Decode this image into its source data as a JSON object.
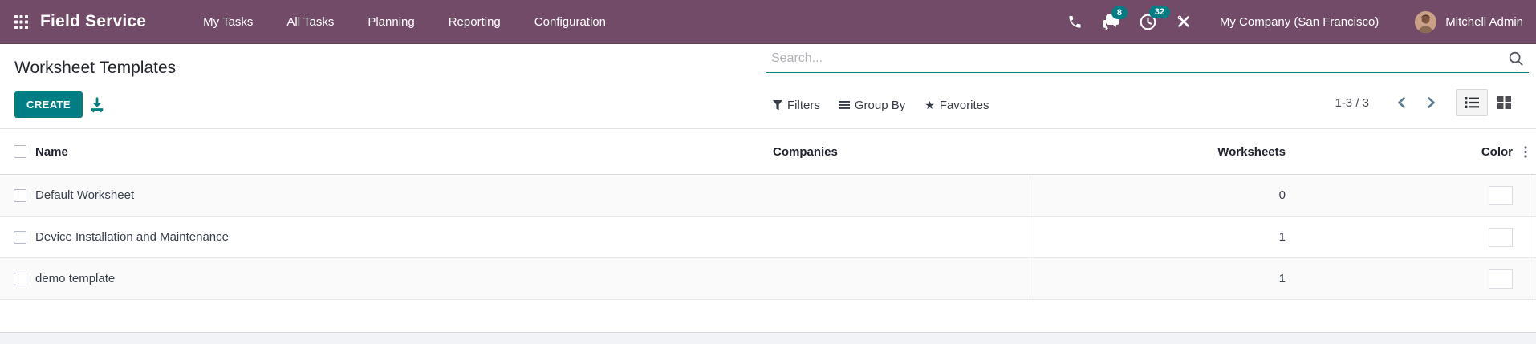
{
  "navbar": {
    "app_name": "Field Service",
    "menu_items": [
      "My Tasks",
      "All Tasks",
      "Planning",
      "Reporting",
      "Configuration"
    ],
    "messages_badge": "8",
    "activities_badge": "32",
    "company_name": "My Company (San Francisco)",
    "user_name": "Mitchell Admin"
  },
  "control_panel": {
    "title": "Worksheet Templates",
    "search_placeholder": "Search...",
    "create_label": "CREATE",
    "filters_label": "Filters",
    "group_by_label": "Group By",
    "favorites_label": "Favorites",
    "pager_text": "1-3 / 3"
  },
  "table": {
    "headers": {
      "name": "Name",
      "companies": "Companies",
      "worksheets": "Worksheets",
      "color": "Color"
    },
    "rows": [
      {
        "name": "Default Worksheet",
        "companies": "",
        "worksheets": "0",
        "color": "#EFA25D"
      },
      {
        "name": "Device Installation and Maintenance",
        "companies": "",
        "worksheets": "1",
        "color": "#F5C81B"
      },
      {
        "name": "demo template",
        "companies": "",
        "worksheets": "1",
        "color": "#EB594C"
      }
    ]
  },
  "colors": {
    "navbar": "#714B67",
    "accent": "#017E84"
  }
}
